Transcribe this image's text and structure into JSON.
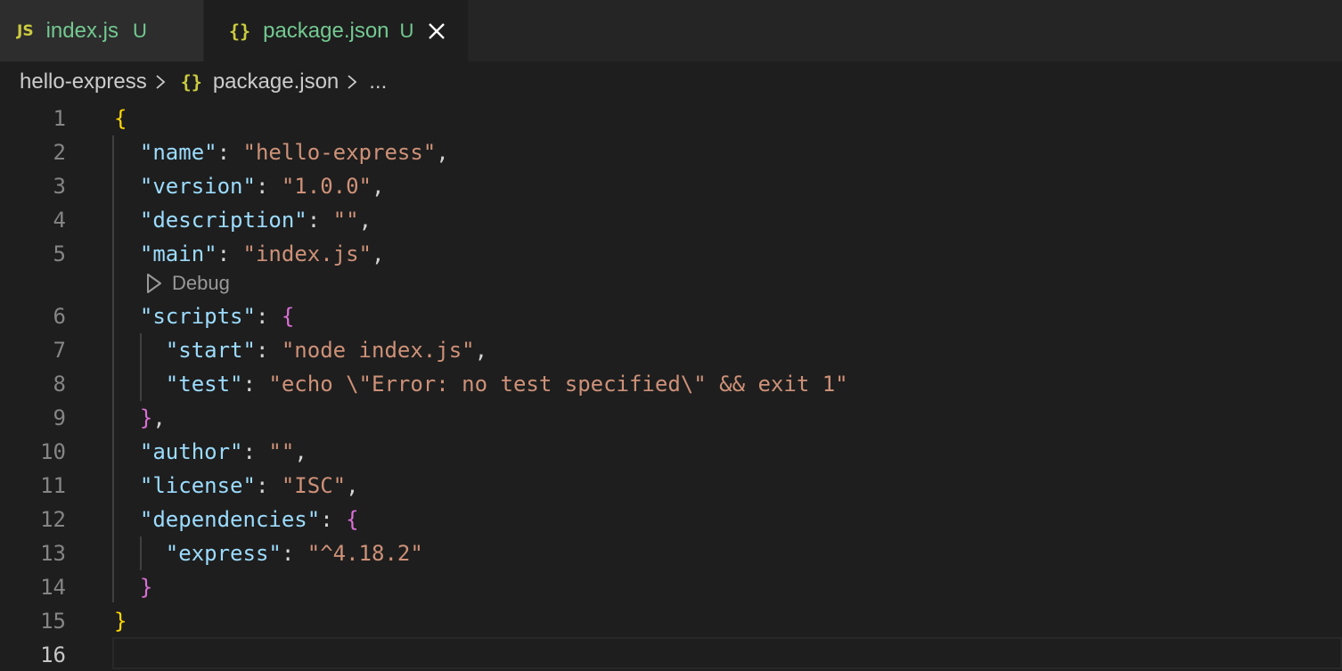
{
  "tabs": [
    {
      "icon": "JS",
      "title": "index.js",
      "badge": "U"
    },
    {
      "icon": "{}",
      "title": "package.json",
      "badge": "U"
    }
  ],
  "breadcrumb": {
    "folder": "hello-express",
    "file_icon": "{}",
    "file": "package.json",
    "more": "..."
  },
  "codelens": {
    "label": "Debug"
  },
  "editor": {
    "line_numbers": [
      "1",
      "2",
      "3",
      "4",
      "5",
      "6",
      "7",
      "8",
      "9",
      "10",
      "11",
      "12",
      "13",
      "14",
      "15",
      "16"
    ],
    "lines": [
      [
        {
          "t": "b1",
          "v": "{"
        }
      ],
      [
        {
          "t": "p",
          "v": "  "
        },
        {
          "t": "k",
          "v": "\"name\""
        },
        {
          "t": "p",
          "v": ": "
        },
        {
          "t": "s",
          "v": "\"hello-express\""
        },
        {
          "t": "p",
          "v": ","
        }
      ],
      [
        {
          "t": "p",
          "v": "  "
        },
        {
          "t": "k",
          "v": "\"version\""
        },
        {
          "t": "p",
          "v": ": "
        },
        {
          "t": "s",
          "v": "\"1.0.0\""
        },
        {
          "t": "p",
          "v": ","
        }
      ],
      [
        {
          "t": "p",
          "v": "  "
        },
        {
          "t": "k",
          "v": "\"description\""
        },
        {
          "t": "p",
          "v": ": "
        },
        {
          "t": "s",
          "v": "\"\""
        },
        {
          "t": "p",
          "v": ","
        }
      ],
      [
        {
          "t": "p",
          "v": "  "
        },
        {
          "t": "k",
          "v": "\"main\""
        },
        {
          "t": "p",
          "v": ": "
        },
        {
          "t": "s",
          "v": "\"index.js\""
        },
        {
          "t": "p",
          "v": ","
        }
      ],
      [
        {
          "t": "p",
          "v": "  "
        },
        {
          "t": "k",
          "v": "\"scripts\""
        },
        {
          "t": "p",
          "v": ": "
        },
        {
          "t": "b2",
          "v": "{"
        }
      ],
      [
        {
          "t": "p",
          "v": "    "
        },
        {
          "t": "k",
          "v": "\"start\""
        },
        {
          "t": "p",
          "v": ": "
        },
        {
          "t": "s",
          "v": "\"node index.js\""
        },
        {
          "t": "p",
          "v": ","
        }
      ],
      [
        {
          "t": "p",
          "v": "    "
        },
        {
          "t": "k",
          "v": "\"test\""
        },
        {
          "t": "p",
          "v": ": "
        },
        {
          "t": "s",
          "v": "\"echo \\\"Error: no test specified\\\" && exit 1\""
        }
      ],
      [
        {
          "t": "p",
          "v": "  "
        },
        {
          "t": "b2",
          "v": "}"
        },
        {
          "t": "p",
          "v": ","
        }
      ],
      [
        {
          "t": "p",
          "v": "  "
        },
        {
          "t": "k",
          "v": "\"author\""
        },
        {
          "t": "p",
          "v": ": "
        },
        {
          "t": "s",
          "v": "\"\""
        },
        {
          "t": "p",
          "v": ","
        }
      ],
      [
        {
          "t": "p",
          "v": "  "
        },
        {
          "t": "k",
          "v": "\"license\""
        },
        {
          "t": "p",
          "v": ": "
        },
        {
          "t": "s",
          "v": "\"ISC\""
        },
        {
          "t": "p",
          "v": ","
        }
      ],
      [
        {
          "t": "p",
          "v": "  "
        },
        {
          "t": "k",
          "v": "\"dependencies\""
        },
        {
          "t": "p",
          "v": ": "
        },
        {
          "t": "b2",
          "v": "{"
        }
      ],
      [
        {
          "t": "p",
          "v": "    "
        },
        {
          "t": "k",
          "v": "\"express\""
        },
        {
          "t": "p",
          "v": ": "
        },
        {
          "t": "s",
          "v": "\"^4.18.2\""
        }
      ],
      [
        {
          "t": "p",
          "v": "  "
        },
        {
          "t": "b2",
          "v": "}"
        }
      ],
      [
        {
          "t": "b1",
          "v": "}"
        }
      ],
      []
    ]
  },
  "colors": {
    "key": "#9cdcfe",
    "string": "#ce9178",
    "bracket_outer": "#ffd700",
    "bracket_inner": "#da70d6",
    "untracked": "#73c991",
    "json_icon": "#cbcb41"
  }
}
